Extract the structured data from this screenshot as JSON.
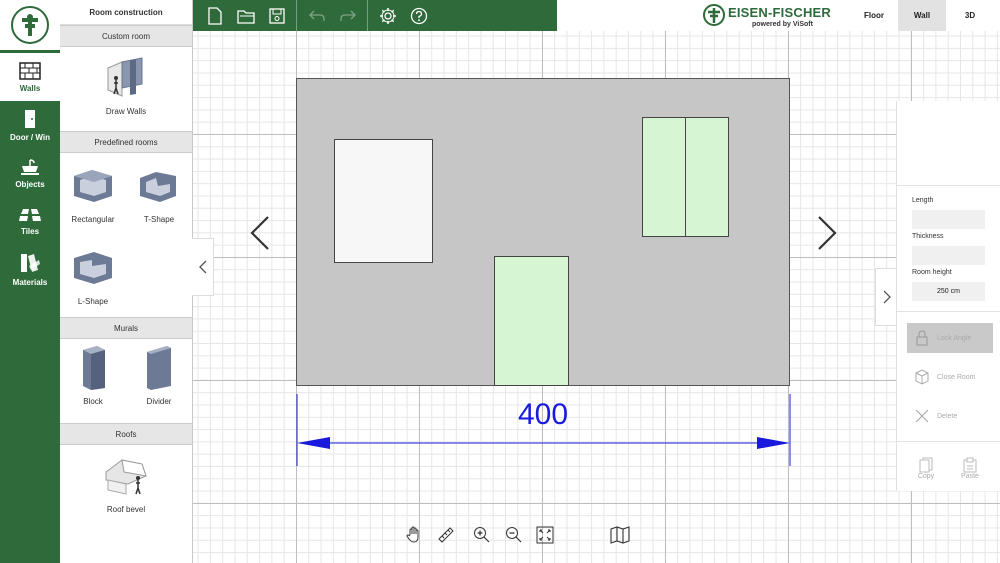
{
  "colors": {
    "brand_green": "#2e6a3a",
    "wall_fill": "#c6c6c6",
    "opening_green": "#d6f5d3",
    "dimension_blue": "#1a1adf"
  },
  "rail": {
    "items": [
      {
        "label": "Walls",
        "icon": "walls-icon"
      },
      {
        "label": "Door / Win",
        "icon": "door-icon"
      },
      {
        "label": "Objects",
        "icon": "objects-icon"
      },
      {
        "label": "Tiles",
        "icon": "tiles-icon"
      },
      {
        "label": "Materials",
        "icon": "materials-icon"
      }
    ]
  },
  "catalog": {
    "title": "Room construction",
    "sections": [
      {
        "header": "Custom room",
        "items": [
          "Draw Walls"
        ]
      },
      {
        "header": "Predefined rooms",
        "items": [
          "Rectangular",
          "T-Shape",
          "L-Shape"
        ]
      },
      {
        "header": "Murals",
        "items": [
          "Block",
          "Divider"
        ]
      },
      {
        "header": "Roofs",
        "items": [
          "Roof bevel"
        ]
      }
    ]
  },
  "toolbar": {
    "icons": [
      "new-file-icon",
      "open-folder-icon",
      "save-icon",
      "undo-icon",
      "redo-icon",
      "settings-icon",
      "help-icon"
    ]
  },
  "brand": {
    "name": "EISEN-FISCHER",
    "subtitle": "powered by ViSoft"
  },
  "view_tabs": [
    {
      "label": "Floor",
      "active": false
    },
    {
      "label": "Wall",
      "active": true
    },
    {
      "label": "3D",
      "active": false
    }
  ],
  "canvas": {
    "dimension_value": "400"
  },
  "properties": {
    "length_label": "Length",
    "length_value": "",
    "thickness_label": "Thickness",
    "thickness_value": "",
    "room_height_label": "Room height",
    "room_height_value": "250 cm",
    "lock_angle": "Lock Angle",
    "close_room": "Close Room",
    "delete": "Delete",
    "copy": "Copy",
    "paste": "Paste"
  },
  "bottom_tools": [
    "pan-hand-icon",
    "measure-ruler-icon",
    "zoom-in-icon",
    "zoom-out-icon",
    "fit-view-icon",
    "map-icon"
  ]
}
